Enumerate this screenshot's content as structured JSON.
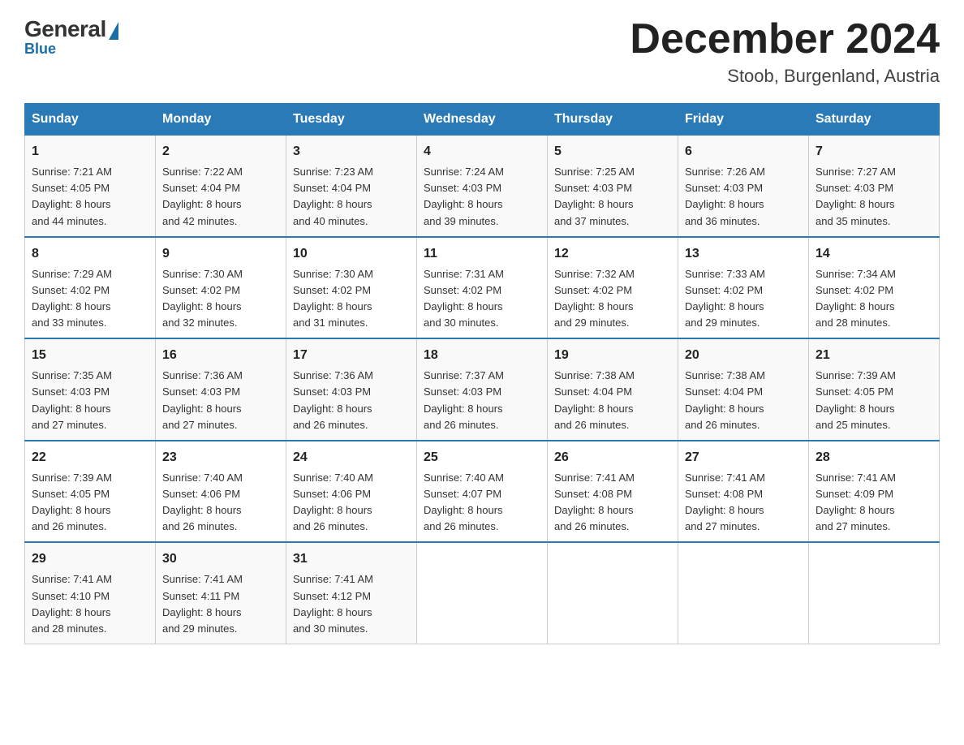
{
  "logo": {
    "general": "General",
    "blue": "Blue"
  },
  "title": "December 2024",
  "subtitle": "Stoob, Burgenland, Austria",
  "days_of_week": [
    "Sunday",
    "Monday",
    "Tuesday",
    "Wednesday",
    "Thursday",
    "Friday",
    "Saturday"
  ],
  "weeks": [
    [
      {
        "day": "1",
        "sunrise": "7:21 AM",
        "sunset": "4:05 PM",
        "daylight": "8 hours and 44 minutes."
      },
      {
        "day": "2",
        "sunrise": "7:22 AM",
        "sunset": "4:04 PM",
        "daylight": "8 hours and 42 minutes."
      },
      {
        "day": "3",
        "sunrise": "7:23 AM",
        "sunset": "4:04 PM",
        "daylight": "8 hours and 40 minutes."
      },
      {
        "day": "4",
        "sunrise": "7:24 AM",
        "sunset": "4:03 PM",
        "daylight": "8 hours and 39 minutes."
      },
      {
        "day": "5",
        "sunrise": "7:25 AM",
        "sunset": "4:03 PM",
        "daylight": "8 hours and 37 minutes."
      },
      {
        "day": "6",
        "sunrise": "7:26 AM",
        "sunset": "4:03 PM",
        "daylight": "8 hours and 36 minutes."
      },
      {
        "day": "7",
        "sunrise": "7:27 AM",
        "sunset": "4:03 PM",
        "daylight": "8 hours and 35 minutes."
      }
    ],
    [
      {
        "day": "8",
        "sunrise": "7:29 AM",
        "sunset": "4:02 PM",
        "daylight": "8 hours and 33 minutes."
      },
      {
        "day": "9",
        "sunrise": "7:30 AM",
        "sunset": "4:02 PM",
        "daylight": "8 hours and 32 minutes."
      },
      {
        "day": "10",
        "sunrise": "7:30 AM",
        "sunset": "4:02 PM",
        "daylight": "8 hours and 31 minutes."
      },
      {
        "day": "11",
        "sunrise": "7:31 AM",
        "sunset": "4:02 PM",
        "daylight": "8 hours and 30 minutes."
      },
      {
        "day": "12",
        "sunrise": "7:32 AM",
        "sunset": "4:02 PM",
        "daylight": "8 hours and 29 minutes."
      },
      {
        "day": "13",
        "sunrise": "7:33 AM",
        "sunset": "4:02 PM",
        "daylight": "8 hours and 29 minutes."
      },
      {
        "day": "14",
        "sunrise": "7:34 AM",
        "sunset": "4:02 PM",
        "daylight": "8 hours and 28 minutes."
      }
    ],
    [
      {
        "day": "15",
        "sunrise": "7:35 AM",
        "sunset": "4:03 PM",
        "daylight": "8 hours and 27 minutes."
      },
      {
        "day": "16",
        "sunrise": "7:36 AM",
        "sunset": "4:03 PM",
        "daylight": "8 hours and 27 minutes."
      },
      {
        "day": "17",
        "sunrise": "7:36 AM",
        "sunset": "4:03 PM",
        "daylight": "8 hours and 26 minutes."
      },
      {
        "day": "18",
        "sunrise": "7:37 AM",
        "sunset": "4:03 PM",
        "daylight": "8 hours and 26 minutes."
      },
      {
        "day": "19",
        "sunrise": "7:38 AM",
        "sunset": "4:04 PM",
        "daylight": "8 hours and 26 minutes."
      },
      {
        "day": "20",
        "sunrise": "7:38 AM",
        "sunset": "4:04 PM",
        "daylight": "8 hours and 26 minutes."
      },
      {
        "day": "21",
        "sunrise": "7:39 AM",
        "sunset": "4:05 PM",
        "daylight": "8 hours and 25 minutes."
      }
    ],
    [
      {
        "day": "22",
        "sunrise": "7:39 AM",
        "sunset": "4:05 PM",
        "daylight": "8 hours and 26 minutes."
      },
      {
        "day": "23",
        "sunrise": "7:40 AM",
        "sunset": "4:06 PM",
        "daylight": "8 hours and 26 minutes."
      },
      {
        "day": "24",
        "sunrise": "7:40 AM",
        "sunset": "4:06 PM",
        "daylight": "8 hours and 26 minutes."
      },
      {
        "day": "25",
        "sunrise": "7:40 AM",
        "sunset": "4:07 PM",
        "daylight": "8 hours and 26 minutes."
      },
      {
        "day": "26",
        "sunrise": "7:41 AM",
        "sunset": "4:08 PM",
        "daylight": "8 hours and 26 minutes."
      },
      {
        "day": "27",
        "sunrise": "7:41 AM",
        "sunset": "4:08 PM",
        "daylight": "8 hours and 27 minutes."
      },
      {
        "day": "28",
        "sunrise": "7:41 AM",
        "sunset": "4:09 PM",
        "daylight": "8 hours and 27 minutes."
      }
    ],
    [
      {
        "day": "29",
        "sunrise": "7:41 AM",
        "sunset": "4:10 PM",
        "daylight": "8 hours and 28 minutes."
      },
      {
        "day": "30",
        "sunrise": "7:41 AM",
        "sunset": "4:11 PM",
        "daylight": "8 hours and 29 minutes."
      },
      {
        "day": "31",
        "sunrise": "7:41 AM",
        "sunset": "4:12 PM",
        "daylight": "8 hours and 30 minutes."
      },
      null,
      null,
      null,
      null
    ]
  ],
  "labels": {
    "sunrise": "Sunrise:",
    "sunset": "Sunset:",
    "daylight": "Daylight:"
  }
}
